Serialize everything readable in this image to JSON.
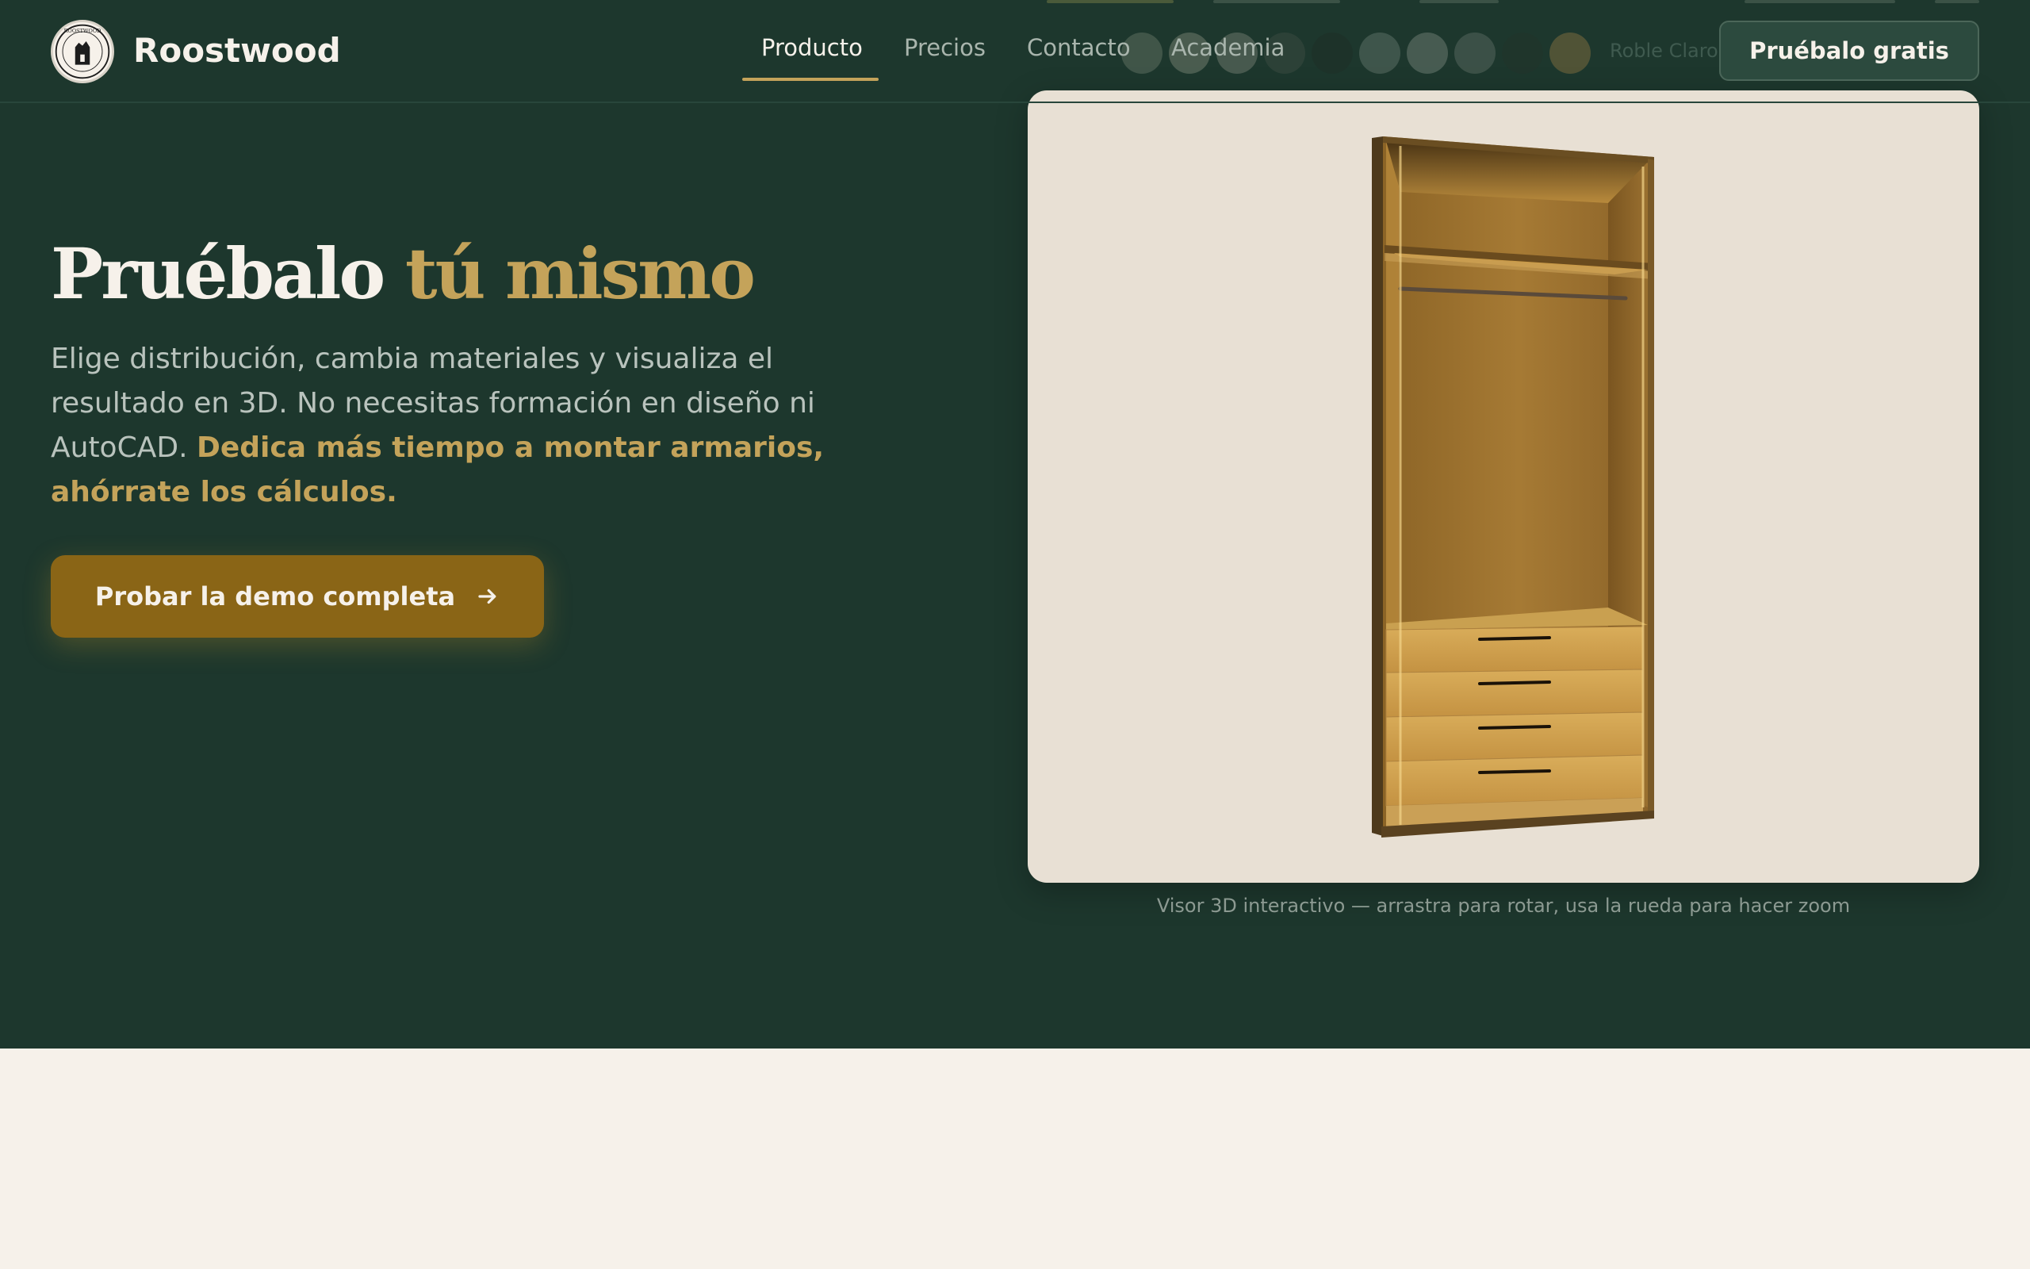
{
  "header": {
    "brand": "Roostwood",
    "logo_text": "ROOSTWOOD",
    "nav": [
      {
        "label": "Producto",
        "active": true
      },
      {
        "label": "Precios",
        "active": false
      },
      {
        "label": "Contacto",
        "active": false
      },
      {
        "label": "Academia",
        "active": false
      }
    ],
    "cta_label": "Pruébalo gratis"
  },
  "swatches": {
    "selected_label": "Roble Claro",
    "colors": [
      "#5d6e5f",
      "#6f7b6c",
      "#6b766a",
      "#3a4a40",
      "#1e2f27",
      "#5a6e64",
      "#6a7a70",
      "#55665d",
      "#22342b",
      "#7a6a3e"
    ]
  },
  "hero": {
    "title_main": "Pruébalo",
    "title_accent": "tú mismo",
    "description": "Elige distribución, cambia materiales y visualiza el resultado en 3D. No necesitas formación en diseño ni AutoCAD.",
    "description_strong": "Dedica más tiempo a montar armarios, ahórrate los cálculos.",
    "cta_label": "Probar la demo completa",
    "cta_icon": "arrow-right-icon"
  },
  "viewer": {
    "caption": "Visor 3D interactivo — arrastra para rotar, usa la rueda para hacer zoom"
  },
  "colors": {
    "hero_bg": "#1d372d",
    "accent": "#c4a35a",
    "cta_bg": "#8a6516",
    "page_bg": "#f6f1ea",
    "viewer_bg": "#e8e0d4"
  }
}
